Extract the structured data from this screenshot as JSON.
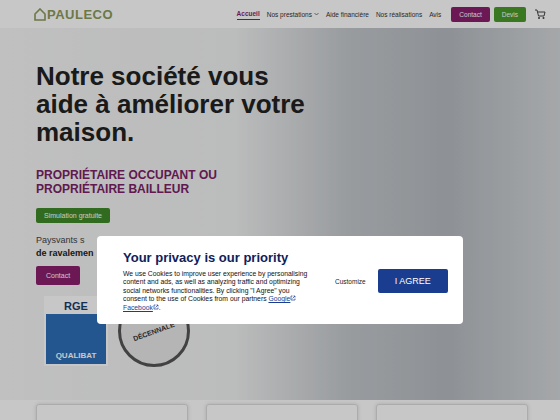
{
  "header": {
    "logo": "PAULECO",
    "nav": [
      {
        "label": "Accueil",
        "selected": true,
        "has_menu": false
      },
      {
        "label": "Nos prestations",
        "selected": false,
        "has_menu": true
      },
      {
        "label": "Aide financière",
        "selected": false,
        "has_menu": false
      },
      {
        "label": "Nos réalisations",
        "selected": false,
        "has_menu": false
      },
      {
        "label": "Avis",
        "selected": false,
        "has_menu": false
      }
    ],
    "buttons": [
      {
        "label": "Contact",
        "color": "#8a1f6e"
      },
      {
        "label": "Devis",
        "color": "#4a9a2a"
      }
    ]
  },
  "hero": {
    "title": "Notre société vous aide à améliorer votre maison.",
    "subtitle": "PROPRIÉTAIRE OCCUPANT OU PROPRIÉTAIRE BAILLEUR",
    "primary_button": "Simulation gratuite",
    "text_lines": [
      "Paysvants s",
      "de ravalemen"
    ],
    "secondary_button": "Contact"
  },
  "badges": {
    "rge": {
      "top": "RGE",
      "main": "QUALIBAT"
    },
    "decennale": "DÉCENNALE"
  },
  "consent": {
    "title": "Your privacy is our priority",
    "body": [
      {
        "kind": "text",
        "text": "We use Cookies to improve user experience by personalising content and ads, as well as analyzing traffic and optimizing social networks functionalities. By clicking \"I Agree\" you consent to the use of Cookies from our partners "
      },
      {
        "kind": "link",
        "text": "Google"
      },
      {
        "kind": "text",
        "text": " "
      },
      {
        "kind": "link",
        "text": "Facebook"
      },
      {
        "kind": "text",
        "text": "."
      }
    ],
    "customize": "Customize",
    "agree": "I AGREE"
  }
}
